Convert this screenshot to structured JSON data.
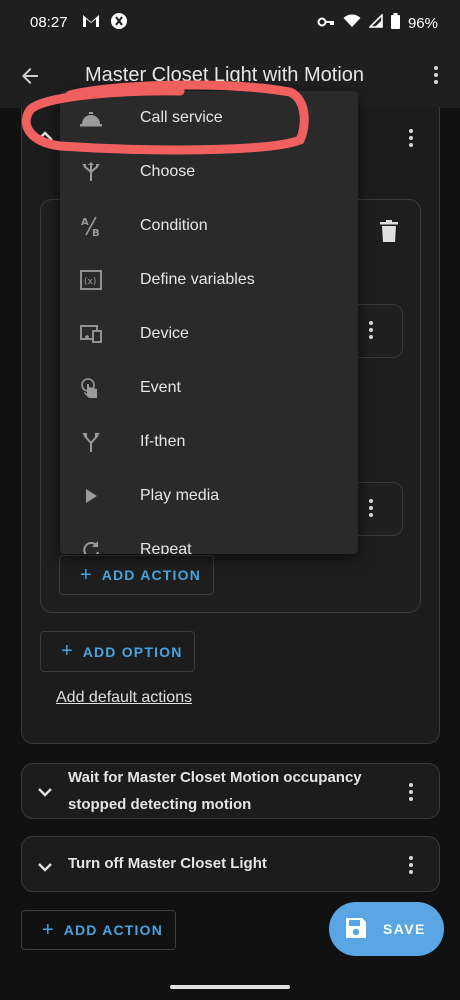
{
  "status_bar": {
    "time": "08:27",
    "battery": "96%"
  },
  "app_bar": {
    "title": "Master Closet Light with Motion"
  },
  "menu": {
    "items": [
      {
        "label": "Call service",
        "icon": "bell-service-icon"
      },
      {
        "label": "Choose",
        "icon": "arrows-split-icon"
      },
      {
        "label": "Condition",
        "icon": "a-slash-b-icon"
      },
      {
        "label": "Define variables",
        "icon": "variable-icon"
      },
      {
        "label": "Device",
        "icon": "devices-icon"
      },
      {
        "label": "Event",
        "icon": "gesture-tap-icon"
      },
      {
        "label": "If-then",
        "icon": "call-split-icon"
      },
      {
        "label": "Play media",
        "icon": "play-icon"
      },
      {
        "label": "Repeat",
        "icon": "refresh-icon"
      }
    ]
  },
  "inner": {
    "add_action": "ADD ACTION",
    "add_option": "ADD OPTION",
    "add_default_actions": "Add default actions"
  },
  "actions": [
    {
      "line1": "Wait for Master Closet Motion occupancy",
      "line2": "stopped detecting motion"
    },
    {
      "line1": "Turn off Master Closet Light"
    }
  ],
  "bottom": {
    "add_action": "ADD ACTION",
    "save": "SAVE"
  },
  "colors": {
    "accent": "#4aa3df",
    "fab": "#5aa6e4",
    "annotation": "#f0605e"
  }
}
